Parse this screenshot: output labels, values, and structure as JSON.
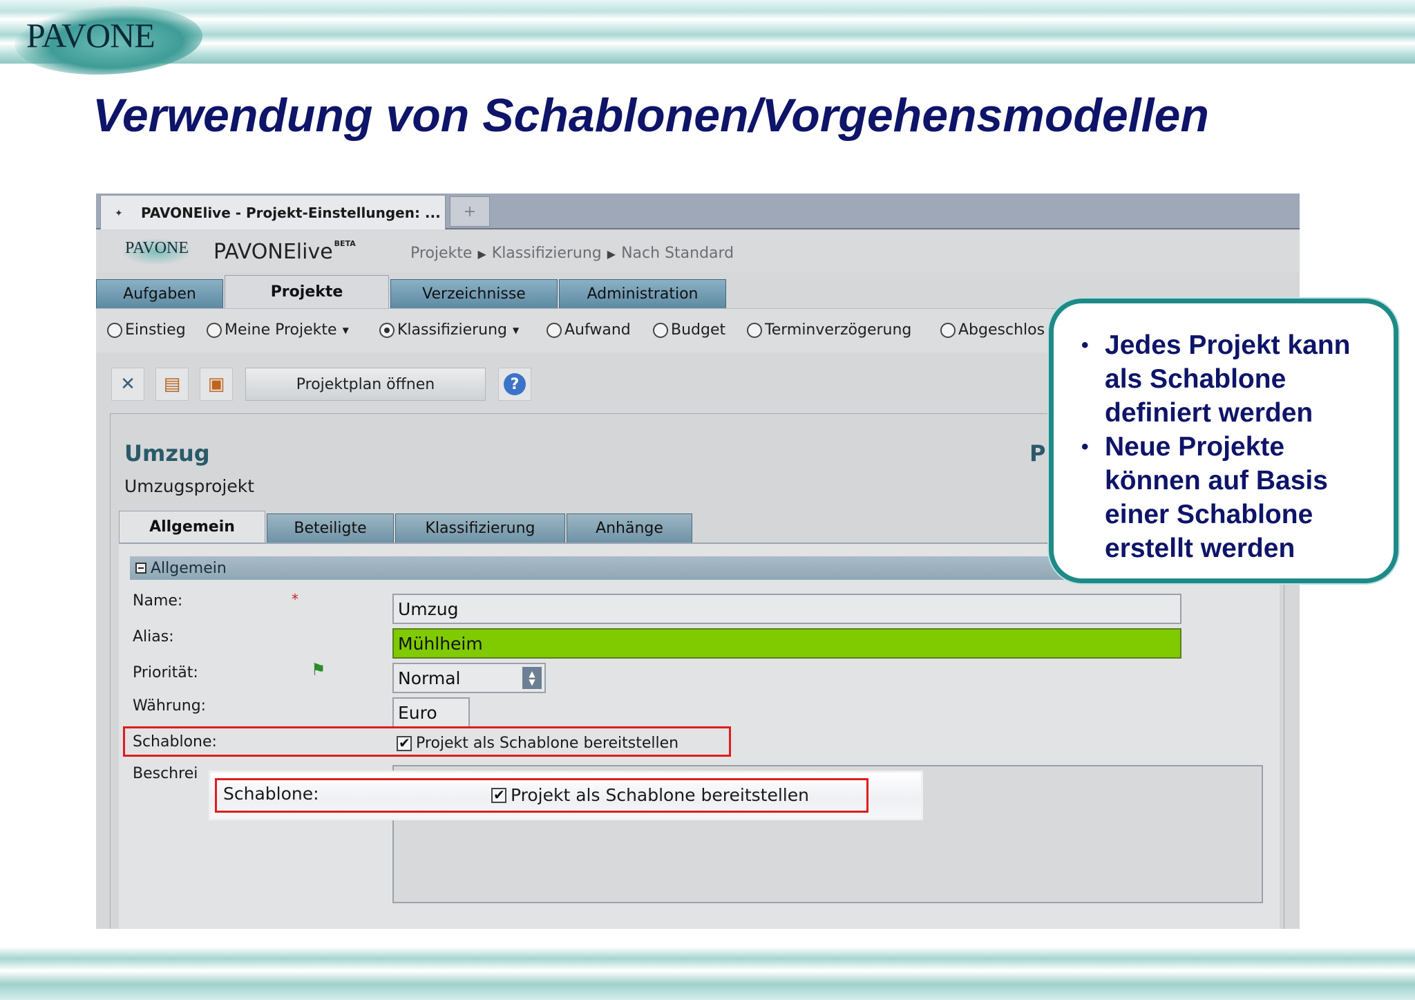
{
  "slide": {
    "logo": "PAVONE",
    "title": "Verwendung von Schablonen/Vorgehensmodellen"
  },
  "browser": {
    "tab_title": "PAVONElive - Projekt-Einstellungen: ...",
    "new_tab_symbol": "+"
  },
  "app": {
    "logo": "PAVONE",
    "name": "PAVONElive",
    "badge": "BETA",
    "breadcrumb": [
      "Projekte",
      "Klassifizierung",
      "Nach Standard"
    ]
  },
  "main_tabs": [
    {
      "label": "Aufgaben",
      "active": false
    },
    {
      "label": "Projekte",
      "active": true
    },
    {
      "label": "Verzeichnisse",
      "active": false
    },
    {
      "label": "Administration",
      "active": false
    }
  ],
  "filters": [
    {
      "label": "Einstieg",
      "selected": false,
      "dropdown": false
    },
    {
      "label": "Meine Projekte",
      "selected": false,
      "dropdown": true
    },
    {
      "label": "Klassifizierung",
      "selected": true,
      "dropdown": true
    },
    {
      "label": "Aufwand",
      "selected": false,
      "dropdown": false
    },
    {
      "label": "Budget",
      "selected": false,
      "dropdown": false
    },
    {
      "label": "Terminverzögerung",
      "selected": false,
      "dropdown": false
    },
    {
      "label": "Abgeschlos",
      "selected": false,
      "dropdown": false
    }
  ],
  "toolbar": {
    "icons": [
      "close-icon",
      "discard-icon",
      "save-icon",
      "help-icon"
    ],
    "plan_button": "Projektplan öffnen"
  },
  "project": {
    "title": "Umzug",
    "right_heading": "Pr",
    "subtitle": "Umzugsprojekt"
  },
  "sub_tabs": [
    {
      "label": "Allgemein",
      "active": true
    },
    {
      "label": "Beteiligte",
      "active": false
    },
    {
      "label": "Klassifizierung",
      "active": false
    },
    {
      "label": "Anhänge",
      "active": false
    }
  ],
  "section": {
    "label": "Allgemein"
  },
  "form": {
    "name_label": "Name:",
    "required_mark": "*",
    "name_value": "Umzug",
    "alias_label": "Alias:",
    "alias_value": "Mühlheim",
    "priority_label": "Priorität:",
    "priority_value": "Normal",
    "currency_label": "Währung:",
    "currency_value": "Euro",
    "template_label": "Schablone:",
    "template_checkbox_label": "Projekt als Schablone bereitstellen",
    "template_checked": true,
    "description_label": "Beschrei"
  },
  "zoom_inset": {
    "label": "Schablone:",
    "checkbox_label": "Projekt als Schablone bereitstellen"
  },
  "callout": {
    "items": [
      "Jedes Projekt kann als Schablone definiert werden",
      "Neue Projekte können auf Basis einer Schablone erstellt werden"
    ],
    "border_color": "#1e8a88",
    "text_color": "#0e1468"
  },
  "colors": {
    "title": "#0e1468",
    "alias_highlight": "#7fcb00",
    "highlight_box": "#e01c1c"
  }
}
